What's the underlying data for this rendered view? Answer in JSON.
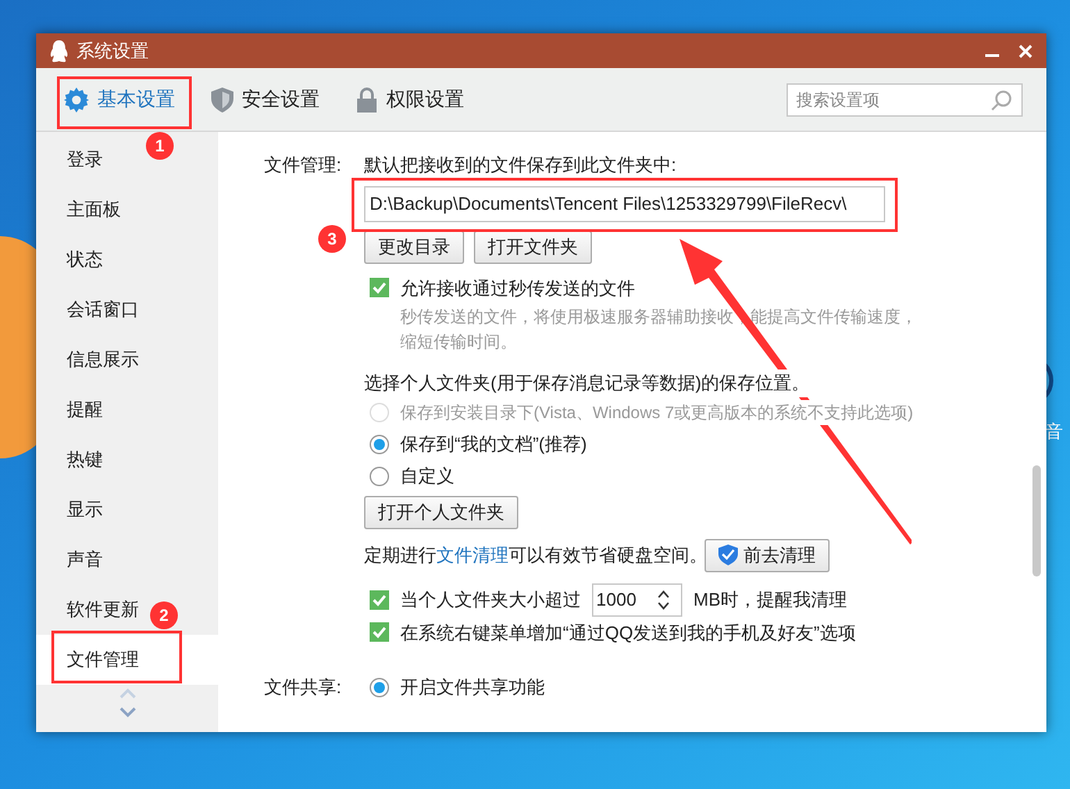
{
  "window": {
    "title": "系统设置"
  },
  "tabs": [
    {
      "label": "基本设置",
      "selected": true
    },
    {
      "label": "安全设置",
      "selected": false
    },
    {
      "label": "权限设置",
      "selected": false
    }
  ],
  "search": {
    "placeholder": "搜索设置项"
  },
  "sidebar": {
    "items": [
      {
        "label": "登录",
        "selected": false
      },
      {
        "label": "主面板",
        "selected": false
      },
      {
        "label": "状态",
        "selected": false
      },
      {
        "label": "会话窗口",
        "selected": false
      },
      {
        "label": "信息展示",
        "selected": false
      },
      {
        "label": "提醒",
        "selected": false
      },
      {
        "label": "热键",
        "selected": false
      },
      {
        "label": "显示",
        "selected": false
      },
      {
        "label": "声音",
        "selected": false
      },
      {
        "label": "软件更新",
        "selected": false
      },
      {
        "label": "文件管理",
        "selected": true
      }
    ]
  },
  "file_management": {
    "label": "文件管理:",
    "intro": "默认把接收到的文件保存到此文件夹中:",
    "path": "D:\\Backup\\Documents\\Tencent Files\\1253329799\\FileRecv\\",
    "buttons": [
      "更改目录",
      "打开文件夹"
    ],
    "fast_transfer": {
      "label": "允许接收通过秒传发送的文件",
      "checked": true,
      "description": "秒传发送的文件，将使用极速服务器辅助接收，能提高文件传输速度，缩短传输时间。"
    },
    "personal_folder": {
      "prompt": "选择个人文件夹(用于保存消息记录等数据)的保存位置。",
      "options": [
        {
          "label": "保存到安装目录下(Vista、Windows 7或更高版本的系统不支持此选项)",
          "selected": false,
          "disabled": true
        },
        {
          "label": "保存到“我的文档”(推荐)",
          "selected": true,
          "disabled": false
        },
        {
          "label": "自定义",
          "selected": false,
          "disabled": false
        }
      ],
      "button": "打开个人文件夹"
    },
    "cleanup": {
      "before": "定期进行",
      "link": "文件清理",
      "after": "可以有效节省硬盘空间。",
      "button": "前去清理"
    },
    "size_limit": {
      "checked": true,
      "before": "当个人文件夹大小超过",
      "value": "1000",
      "after": "MB时，提醒我清理"
    },
    "context_menu": {
      "checked": true,
      "label": "在系统右键菜单增加“通过QQ发送到我的手机及好友”选项"
    }
  },
  "file_sharing": {
    "label": "文件共享:",
    "options": [
      {
        "label": "开启文件共享功能",
        "selected": true
      }
    ]
  },
  "desktop": {
    "icon_label": "音"
  },
  "annotations": [
    {
      "label": "1"
    },
    {
      "label": "2"
    },
    {
      "label": "3"
    }
  ]
}
